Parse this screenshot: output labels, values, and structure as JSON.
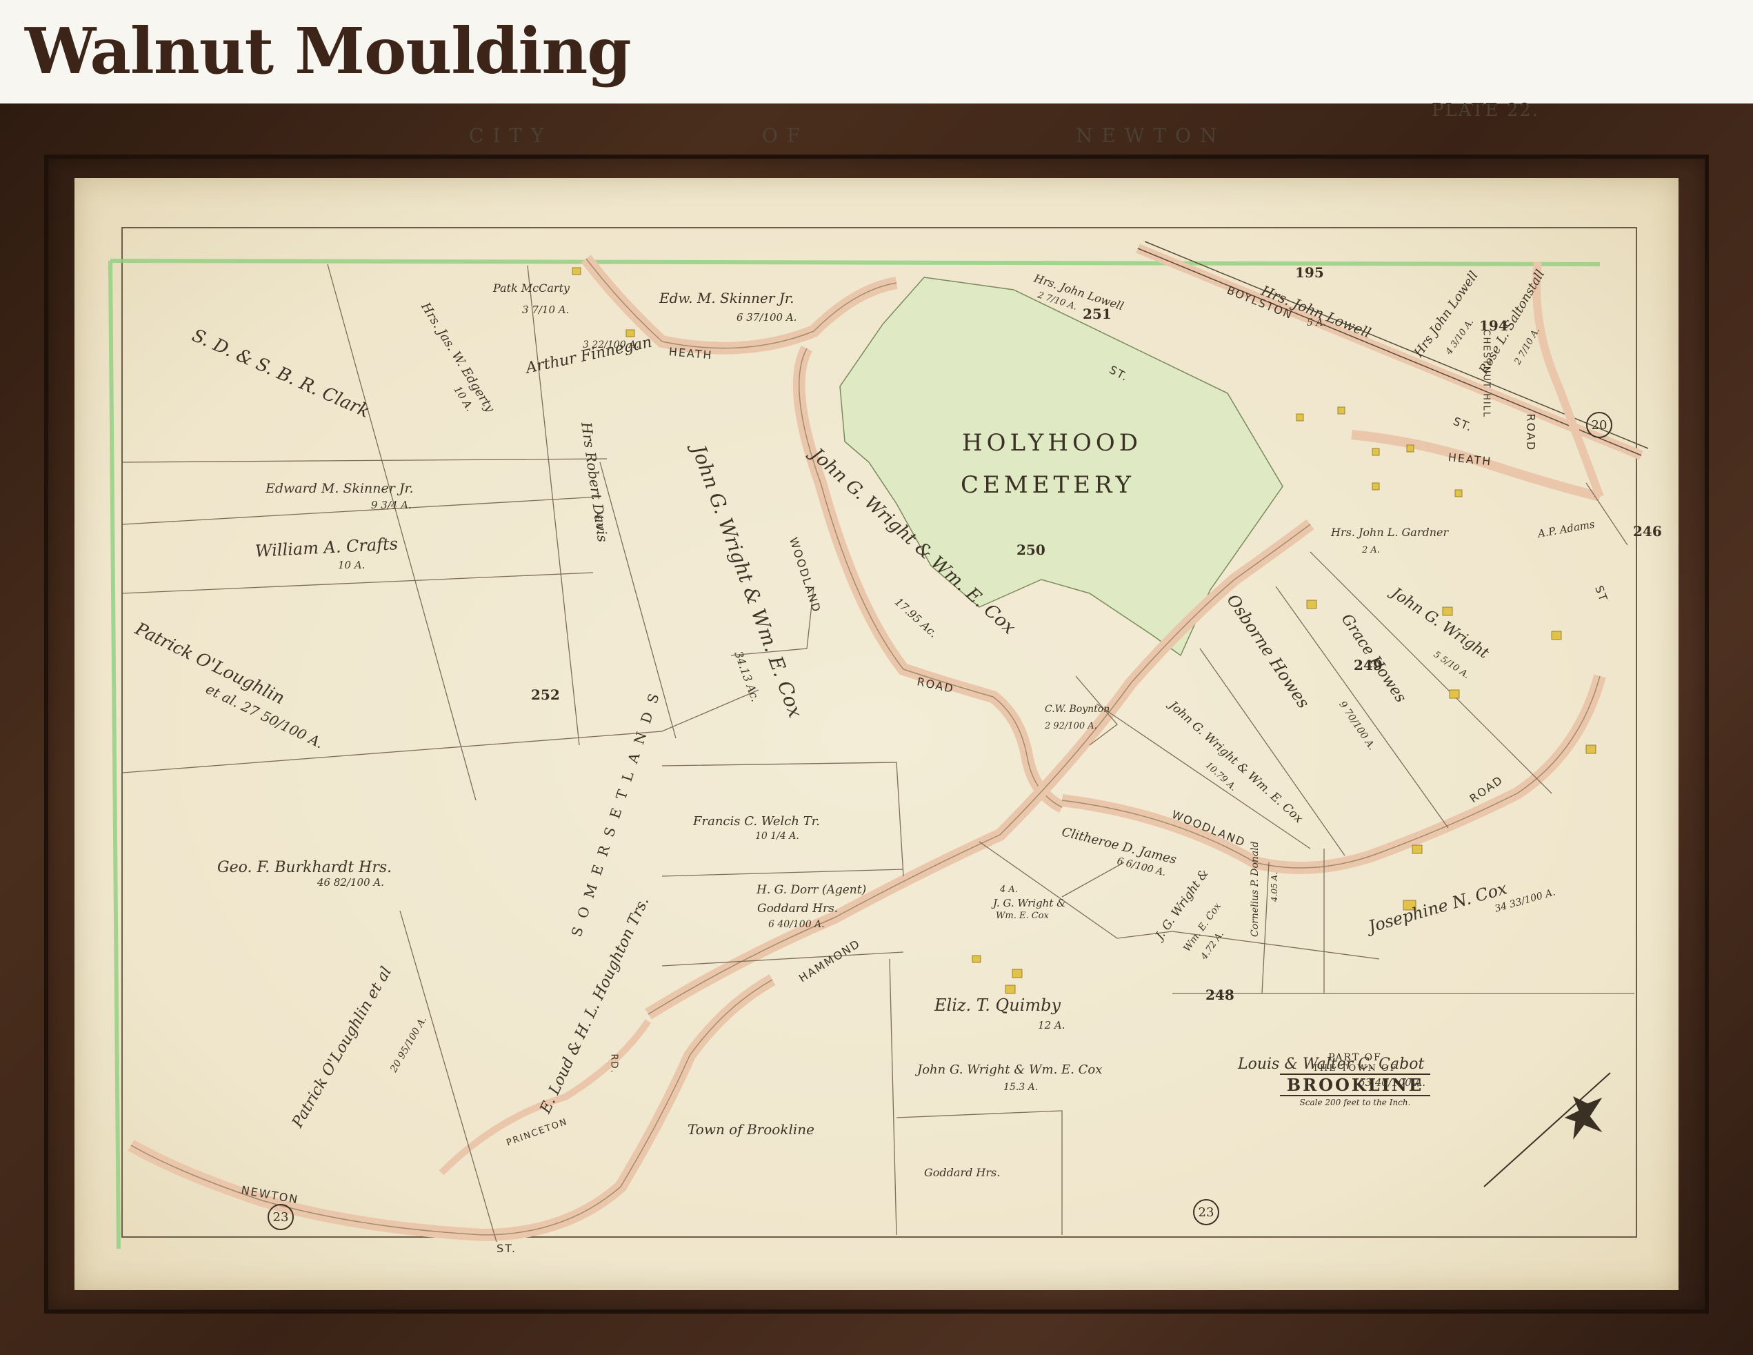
{
  "header": {
    "title": "Walnut Moulding"
  },
  "map": {
    "plate": "PLATE 22.",
    "city_of_newton": [
      "C I T Y",
      "O F",
      "N E W T O N"
    ],
    "cemetery": [
      "HOLYHOOD",
      "CEMETERY"
    ],
    "cartouche": {
      "line1": "PART OF",
      "line2": "THE TOWN OF",
      "line3": "BROOKLINE",
      "scale": "Scale 200 feet to the Inch."
    },
    "roads": {
      "heath_1": "HEATH",
      "heath_2": "HEATH",
      "boylston": "BOYLSTON",
      "st_1": "ST.",
      "st_2": "ST.",
      "st_3": "ST",
      "chestnut_hill": "CHESTNUT HILL",
      "road_1": "ROAD",
      "woodland_1": "WOODLAND",
      "road_2": "ROAD",
      "woodland_2": "WOODLAND",
      "road_3": "ROAD",
      "hammond": "HAMMOND",
      "newton": "NEWTON",
      "princeton": "PRINCETON",
      "rd": "RD.",
      "st_4": "ST."
    },
    "section_numbers": {
      "s195": "195",
      "s194": "194",
      "s251": "251",
      "s250": "250",
      "s252": "252",
      "s249": "249",
      "s248": "248",
      "s246": "246"
    },
    "circled": {
      "c20": "20",
      "c23a": "23",
      "c23b": "23"
    },
    "owners": {
      "clark": "S. D. & S. B. R. Clark",
      "mccarty": "Patk McCarty",
      "mccarty_area": "3 7/10 A.",
      "edgerty": "Hrs. Jas. W. Edgerty",
      "edgerty_area": "10 A.",
      "skinner_jr": "Edw. M. Skinner Jr.",
      "skinner_jr_area": "6 37/100 A.",
      "finnegan": "Arthur Finnegan",
      "finnegan_area": "3 22/100 A.",
      "edward_skinner": "Edward M. Skinner Jr.",
      "edward_skinner_area": "9 3/4 A.",
      "crafts": "William A. Crafts",
      "crafts_area": "10 A.",
      "oloughlin": "Patrick O'Loughlin",
      "oloughlin_area": "et al. 27 50/100 A.",
      "robert_davis": "Hrs Robert Davis",
      "robert_davis_area": "4 a.",
      "jgw_cox": "John G. Wright & Wm. E. Cox",
      "jgw_cox_area": "34.13 Ac.",
      "jgw_cox2": "John G. Wright & Wm. E. Cox",
      "jgw_cox2_area": "17.95 Ac.",
      "burkhardt": "Geo. F. Burkhardt Hrs.",
      "burkhardt_area": "46 82/100 A.",
      "welch": "Francis C. Welch Tr.",
      "welch_area": "10 1/4 A.",
      "dorr": "H. G. Dorr (Agent)",
      "goddard": "Goddard Hrs.",
      "goddard_area": "6 40/100 A.",
      "somerset": "S O M E R S E T   L A N D S",
      "houghton": "E. Loud & H. L. Houghton Trs.",
      "oloughlin2": "Patrick O'Loughlin et al",
      "oloughlin2_area": "20 95/100 A.",
      "town": "Town of Brookline",
      "boynton": "C.W. Boynton",
      "boynton_area": "2 92/100 A.",
      "jgw_cox3": "John G. Wright & Wm. E. Cox",
      "jgw_cox3_area": "10.79 A.",
      "clitheroe": "Clitheroe D. James",
      "clitheroe_area": "6 6/100 A.",
      "jgw_4a": "4 A.",
      "jgw_4": "J. G. Wright &",
      "jgw_4b": "Wm. E. Cox",
      "jgw_5": "J. G. Wright &",
      "jgw_5b": "Wm. E. Cox",
      "jgw_5_area": "4.72 A.",
      "cornelius": "Cornelius P. Donald",
      "cornelius_area": "4.05 A.",
      "josephine": "Josephine N. Cox",
      "josephine_area": "34 33/100 A.",
      "quimby": "Eliz. T. Quimby",
      "quimby_area": "12 A.",
      "jgw_6": "John G. Wright & Wm. E. Cox",
      "jgw_6_area": "15.3 A.",
      "goddard2": "Goddard Hrs.",
      "cabot": "Louis & Walter C. Cabot",
      "cabot_area": "63 40/100 A.",
      "osborne": "Osborne Howes",
      "osborne_area": "9 70/100 A.",
      "grace": "Grace Howes",
      "john_gwright": "John G. Wright",
      "john_gwright_area": "5 5/10 A.",
      "gardner": "Hrs. John L. Gardner",
      "gardner_area": "2 A.",
      "adams": "A.P. Adams",
      "lowell1": "Hrs. John Lowell",
      "lowell1_area": "2 7/10 A.",
      "lowell2": "Hrs. John Lowell",
      "lowell2_area": "5 A.",
      "lowell3": "Hrs John Lowell",
      "lowell3_area": "4 3/10 A.",
      "saltonstall": "Rose L. Saltonstall",
      "saltonstall_area": "2 7/10 A."
    }
  },
  "colors": {
    "frame": "#3a2316",
    "paper": "#efe6cc",
    "road": "#eac7ab",
    "cemetery": "#dfe9c3",
    "boundary_green": "#8fcf7f",
    "building": "#e2c34a"
  }
}
